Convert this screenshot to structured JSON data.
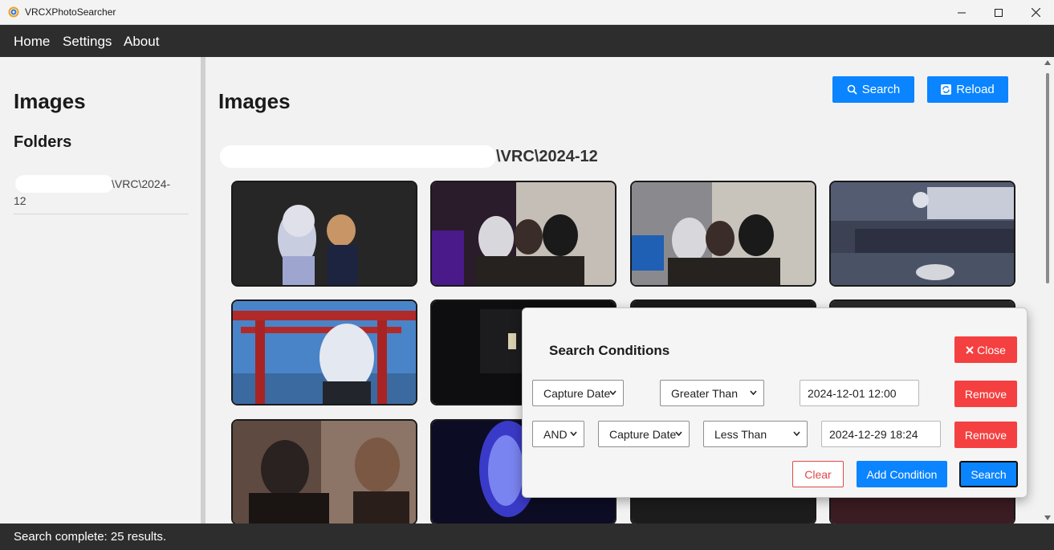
{
  "window": {
    "title": "VRCXPhotoSearcher",
    "icons": [
      "app-icon",
      "minimize-icon",
      "maximize-icon",
      "close-icon"
    ]
  },
  "menu": {
    "home": "Home",
    "settings": "Settings",
    "about": "About"
  },
  "sidebar": {
    "heading": "Images",
    "folders_heading": "Folders",
    "folders": [
      {
        "label": "\\VRC\\2024-12"
      }
    ]
  },
  "main": {
    "heading": "Images",
    "search_label": "Search",
    "reload_label": "Reload",
    "folder_path": "\\VRC\\2024-12",
    "thumbnails": [
      "avatar-photo-1",
      "avatar-photo-2",
      "avatar-photo-3",
      "avatar-photo-4",
      "avatar-photo-5",
      "avatar-photo-6",
      "avatar-photo-7",
      "avatar-photo-8",
      "avatar-photo-9",
      "avatar-photo-10",
      "avatar-photo-11",
      "avatar-photo-12"
    ]
  },
  "dialog": {
    "title": "Search Conditions",
    "close_label": "Close",
    "conditions": [
      {
        "field": "Capture Date",
        "operator": "Greater Than",
        "value": "2024-12-01 12:00",
        "remove_label": "Remove"
      },
      {
        "logic": "AND",
        "field": "Capture Date",
        "operator": "Less Than",
        "value": "2024-12-29 18:24",
        "remove_label": "Remove"
      }
    ],
    "clear_label": "Clear",
    "add_label": "Add Condition",
    "search_label": "Search"
  },
  "status": {
    "text": "Search complete: 25 results."
  },
  "colors": {
    "accent": "#0a84ff",
    "danger": "#f44040",
    "bar": "#2d2d2d"
  }
}
